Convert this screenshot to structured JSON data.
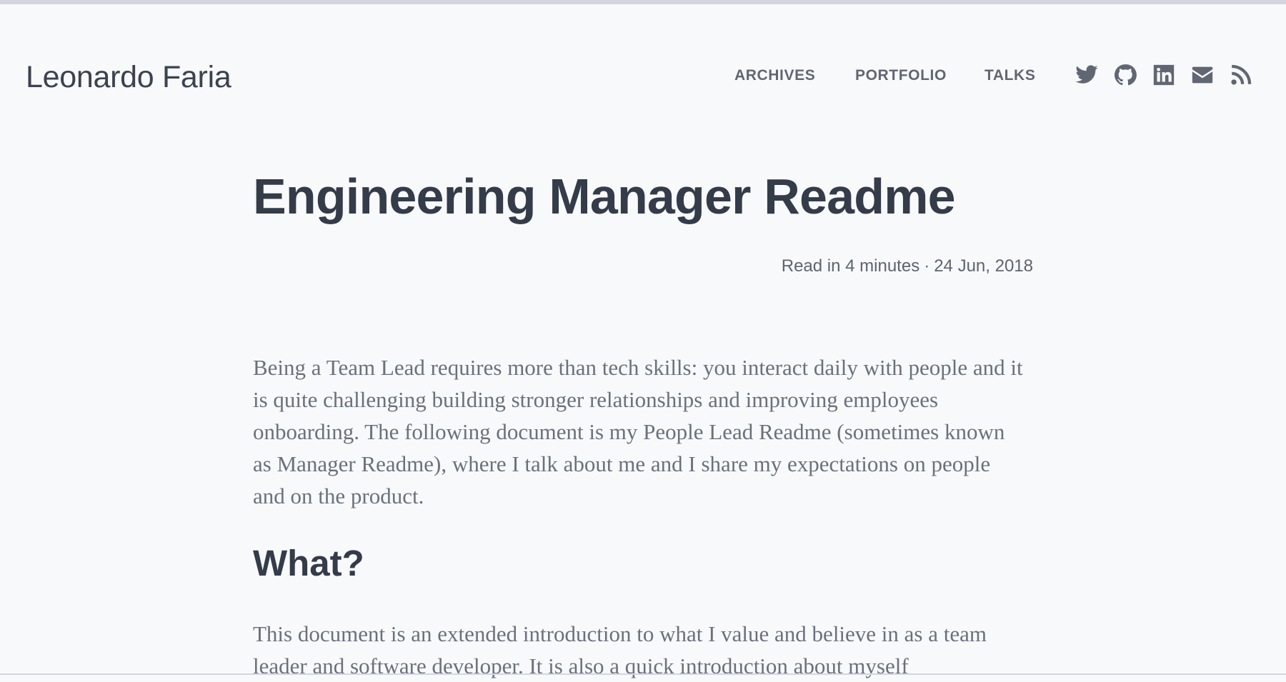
{
  "header": {
    "site_title": "Leonardo Faria",
    "nav": [
      {
        "label": "ARCHIVES"
      },
      {
        "label": "PORTFOLIO"
      },
      {
        "label": "TALKS"
      }
    ],
    "icons": [
      "twitter-icon",
      "github-icon",
      "linkedin-icon",
      "email-icon",
      "rss-icon"
    ]
  },
  "post": {
    "title": "Engineering Manager Readme",
    "read_time": "Read in 4 minutes",
    "separator": "·",
    "date": "24 Jun, 2018",
    "intro": "Being a Team Lead requires more than tech skills: you interact daily with people and it is quite challenging building stronger relationships and improving employees onboarding. The following document is my People Lead Readme (sometimes known as Manager Readme), where I talk about me and I share my expectations on people and on the product.",
    "section_heading": "What?",
    "section_body": "This document is an extended introduction to what I value and believe in as a team leader and software developer. It is also a quick introduction about myself"
  },
  "colors": {
    "background": "#f8f9fb",
    "top_bar": "#d3d6de",
    "heading": "#343b49",
    "body_text": "#6b707c",
    "nav_text": "#606672"
  }
}
